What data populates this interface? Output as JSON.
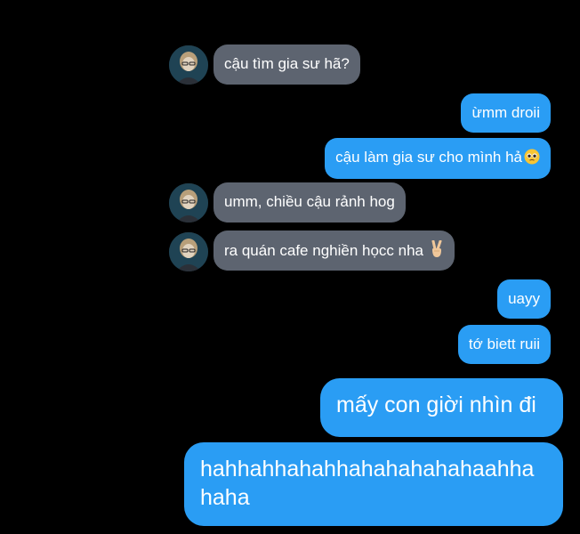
{
  "messages": [
    {
      "direction": "in",
      "text": "cậu tìm gia sư hã?",
      "emoji": null
    },
    {
      "direction": "out",
      "text": "ừmm droii",
      "emoji": null
    },
    {
      "direction": "out",
      "text": "cậu làm gia sư cho mình hả",
      "emoji": "pleading-face-icon"
    },
    {
      "direction": "in",
      "text": "umm, chiều cậu rảnh hog",
      "emoji": null
    },
    {
      "direction": "in",
      "text": "ra quán cafe nghiền họcc nha ",
      "emoji": "victory-hand-icon"
    },
    {
      "direction": "out",
      "text": "uayy",
      "emoji": null
    },
    {
      "direction": "out",
      "text": "tớ biett ruii",
      "emoji": null
    },
    {
      "direction": "out",
      "text": "mấy con giời nhìn đi",
      "emoji": null
    },
    {
      "direction": "out",
      "text": "hahhahhahahhahahahahahaahha haha",
      "emoji": null
    }
  ],
  "colors": {
    "background": "#000000",
    "incoming_bubble": "#5d6470",
    "outgoing_bubble": "#2a9df4",
    "text": "#ffffff"
  }
}
